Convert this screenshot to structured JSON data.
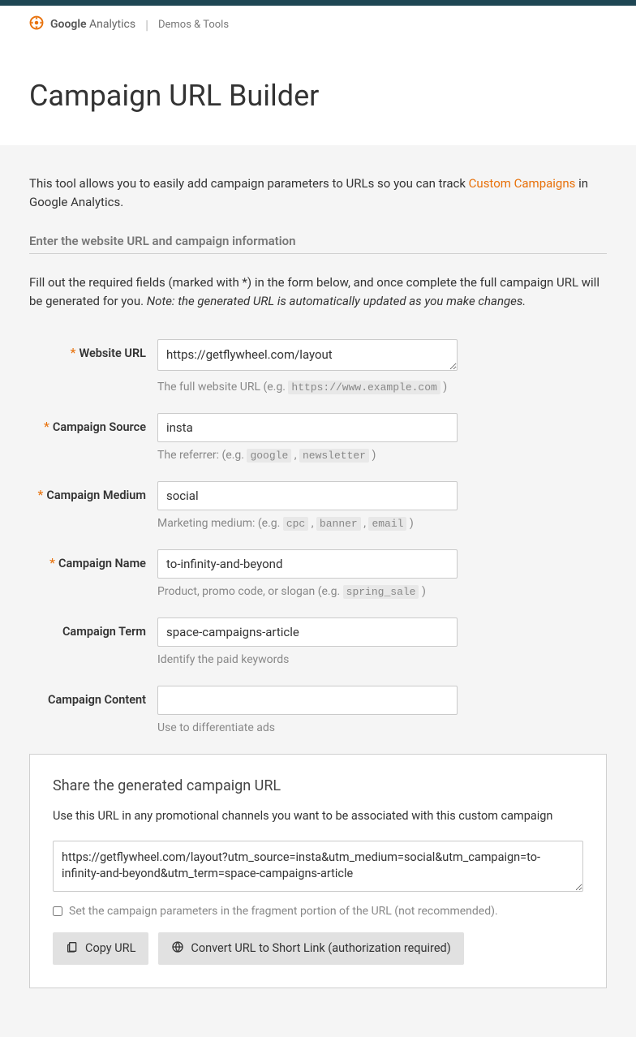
{
  "header": {
    "brand_google": "Google",
    "brand_analytics": "Analytics",
    "demos_tools": "Demos & Tools"
  },
  "page_title": "Campaign URL Builder",
  "intro": {
    "prefix": "This tool allows you to easily add campaign parameters to URLs so you can track ",
    "link_text": "Custom Campaigns",
    "suffix": " in Google Analytics."
  },
  "section_heading": "Enter the website URL and campaign information",
  "instructions": {
    "text": "Fill out the required fields (marked with *) in the form below, and once complete the full campaign URL will be generated for you. ",
    "note": "Note: the generated URL is automatically updated as you make changes."
  },
  "fields": {
    "website_url": {
      "label": "Website URL",
      "value": "https://getflywheel.com/layout",
      "helper_prefix": "The full website URL (e.g. ",
      "helper_code": "https://www.example.com",
      "helper_suffix": " )"
    },
    "source": {
      "label": "Campaign Source",
      "value": "insta",
      "helper_prefix": "The referrer: (e.g. ",
      "helper_code1": "google",
      "helper_code2": "newsletter",
      "helper_suffix": " )"
    },
    "medium": {
      "label": "Campaign Medium",
      "value": "social",
      "helper_prefix": "Marketing medium: (e.g. ",
      "helper_code1": "cpc",
      "helper_code2": "banner",
      "helper_code3": "email",
      "helper_suffix": " )"
    },
    "name": {
      "label": "Campaign Name",
      "value": "to-infinity-and-beyond",
      "helper_prefix": "Product, promo code, or slogan (e.g. ",
      "helper_code": "spring_sale",
      "helper_suffix": " )"
    },
    "term": {
      "label": "Campaign Term",
      "value": "space-campaigns-article",
      "helper": "Identify the paid keywords"
    },
    "content": {
      "label": "Campaign Content",
      "value": "",
      "helper": "Use to differentiate ads"
    }
  },
  "share": {
    "title": "Share the generated campaign URL",
    "desc": "Use this URL in any promotional channels you want to be associated with this custom campaign",
    "generated_url": "https://getflywheel.com/layout?utm_source=insta&utm_medium=social&utm_campaign=to-infinity-and-beyond&utm_term=space-campaigns-article",
    "fragment_label": "Set the campaign parameters in the fragment portion of the URL (not recommended).",
    "copy_button": "Copy URL",
    "convert_button": "Convert URL to Short Link (authorization required)"
  }
}
